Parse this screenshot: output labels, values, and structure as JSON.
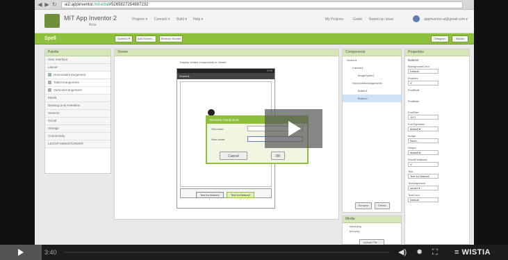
{
  "browser": {
    "url_prefix": "ai2.appinventor.",
    "url_domain": "mit.edu",
    "url_rest": "/#5265827254887232"
  },
  "app": {
    "title": "MIT App Inventor 2",
    "beta": "Beta",
    "menus": [
      "Projects ▾",
      "Connect ▾",
      "Build ▾",
      "Help ▾"
    ],
    "right_menus": [
      "My Projects",
      "Guide",
      "Report an Issue"
    ],
    "account": "appinventor.ai@gmail.com ▾"
  },
  "toolbar": {
    "project": "Spell",
    "buttons": [
      "Screen1 ▾",
      "Add Screen...",
      "Remove Screen"
    ],
    "right_buttons": [
      "Designer",
      "Blocks"
    ]
  },
  "palette": {
    "title": "Palette",
    "items": [
      {
        "label": "User Interface",
        "sub": false
      },
      {
        "label": "Layout",
        "sub": false
      },
      {
        "label": "HorizontalArrangement",
        "sub": true
      },
      {
        "label": "TableArrangement",
        "sub": true
      },
      {
        "label": "VerticalArrangement",
        "sub": true
      },
      {
        "label": "Media",
        "sub": false
      },
      {
        "label": "Drawing and Animation",
        "sub": false
      },
      {
        "label": "Sensors",
        "sub": false
      },
      {
        "label": "Social",
        "sub": false
      },
      {
        "label": "Storage",
        "sub": false
      },
      {
        "label": "Connectivity",
        "sub": false
      },
      {
        "label": "LEGO® MINDSTORMS®",
        "sub": false
      }
    ]
  },
  "viewer": {
    "title": "Viewer",
    "hidden_check": "Display hidden components in Viewer",
    "screen_title": "Screen1",
    "status_time": "5:09",
    "button1": "Text for Button1",
    "button2": "Text for Button2"
  },
  "dialog": {
    "title": "Rename Component",
    "old_label": "Old name:",
    "new_label": "New name:",
    "cancel": "Cancel",
    "ok": "OK"
  },
  "components": {
    "title": "Components",
    "tree": [
      "Screen1",
      "Canvas1",
      "ImageSprite1",
      "HorizontalArrangement1",
      "Button1",
      "Button2"
    ],
    "rename": "Rename",
    "delete": "Delete"
  },
  "media": {
    "title": "Media",
    "files": [
      "hand.png",
      "bird.png"
    ],
    "upload": "Upload File ..."
  },
  "properties": {
    "title": "Properties",
    "component": "Button2",
    "items": [
      {
        "label": "BackgroundColor",
        "value": "Default"
      },
      {
        "label": "Enabled",
        "value": "✔"
      },
      {
        "label": "FontBold",
        "value": ""
      },
      {
        "label": "FontItalic",
        "value": ""
      },
      {
        "label": "FontSize",
        "value": "14.0"
      },
      {
        "label": "FontTypeface",
        "value": "default ▾"
      },
      {
        "label": "Image",
        "value": "None..."
      },
      {
        "label": "Shape",
        "value": "default ▾"
      },
      {
        "label": "ShowFeedback",
        "value": "✔"
      },
      {
        "label": "Text",
        "value": "Text for Button2"
      },
      {
        "label": "TextAlignment",
        "value": "center ▾"
      },
      {
        "label": "TextColor",
        "value": "Default"
      }
    ]
  },
  "player": {
    "time": "3:40",
    "brand": "WISTIA",
    "volume_icon": "volume-icon",
    "settings_icon": "gear-icon",
    "fullscreen_icon": "fullscreen-icon"
  }
}
